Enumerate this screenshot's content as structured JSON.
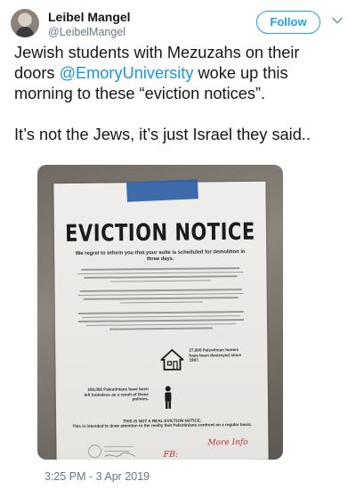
{
  "user": {
    "display_name": "Leibel Mangel",
    "handle": "@LeibelMangel"
  },
  "follow_label": "Follow",
  "tweet": {
    "text_before_mention": "Jewish students with Mezuzahs on their doors ",
    "mention": "@EmoryUniversity",
    "text_after_mention": " woke up this morning to these “eviction notices”.",
    "second_paragraph": "It’s not the Jews, it’s just Israel they said.."
  },
  "photo": {
    "notice_title": "EVICTION NOTICE",
    "notice_subtitle": "We regret to inform you that your suite is scheduled for demolition in three days.",
    "house_stat": "27,000 Palestinian homes have been destroyed since 1967.",
    "person_stat": "100,000 Palestinians have been left homeless as a result of these policies.",
    "disclaimer_title": "THIS IS NOT A REAL EVICTION NOTICE.",
    "disclaimer_body": "This is intended to draw attention to the reality that Palestinians confront on a regular basis.",
    "handwriting_1": "More Info",
    "handwriting_2": "FB: @sjpemoryuniversity"
  },
  "timestamp": "3:25 PM - 3 Apr 2019",
  "colors": {
    "accent": "#1da1f2",
    "mention": "#1b95e0",
    "secondary_text": "#657786",
    "tape": "#2f5fa6",
    "handwriting": "#b8312f"
  },
  "icons": {
    "caret": "chevron-down-icon",
    "house": "house-icon",
    "person": "person-icon"
  }
}
